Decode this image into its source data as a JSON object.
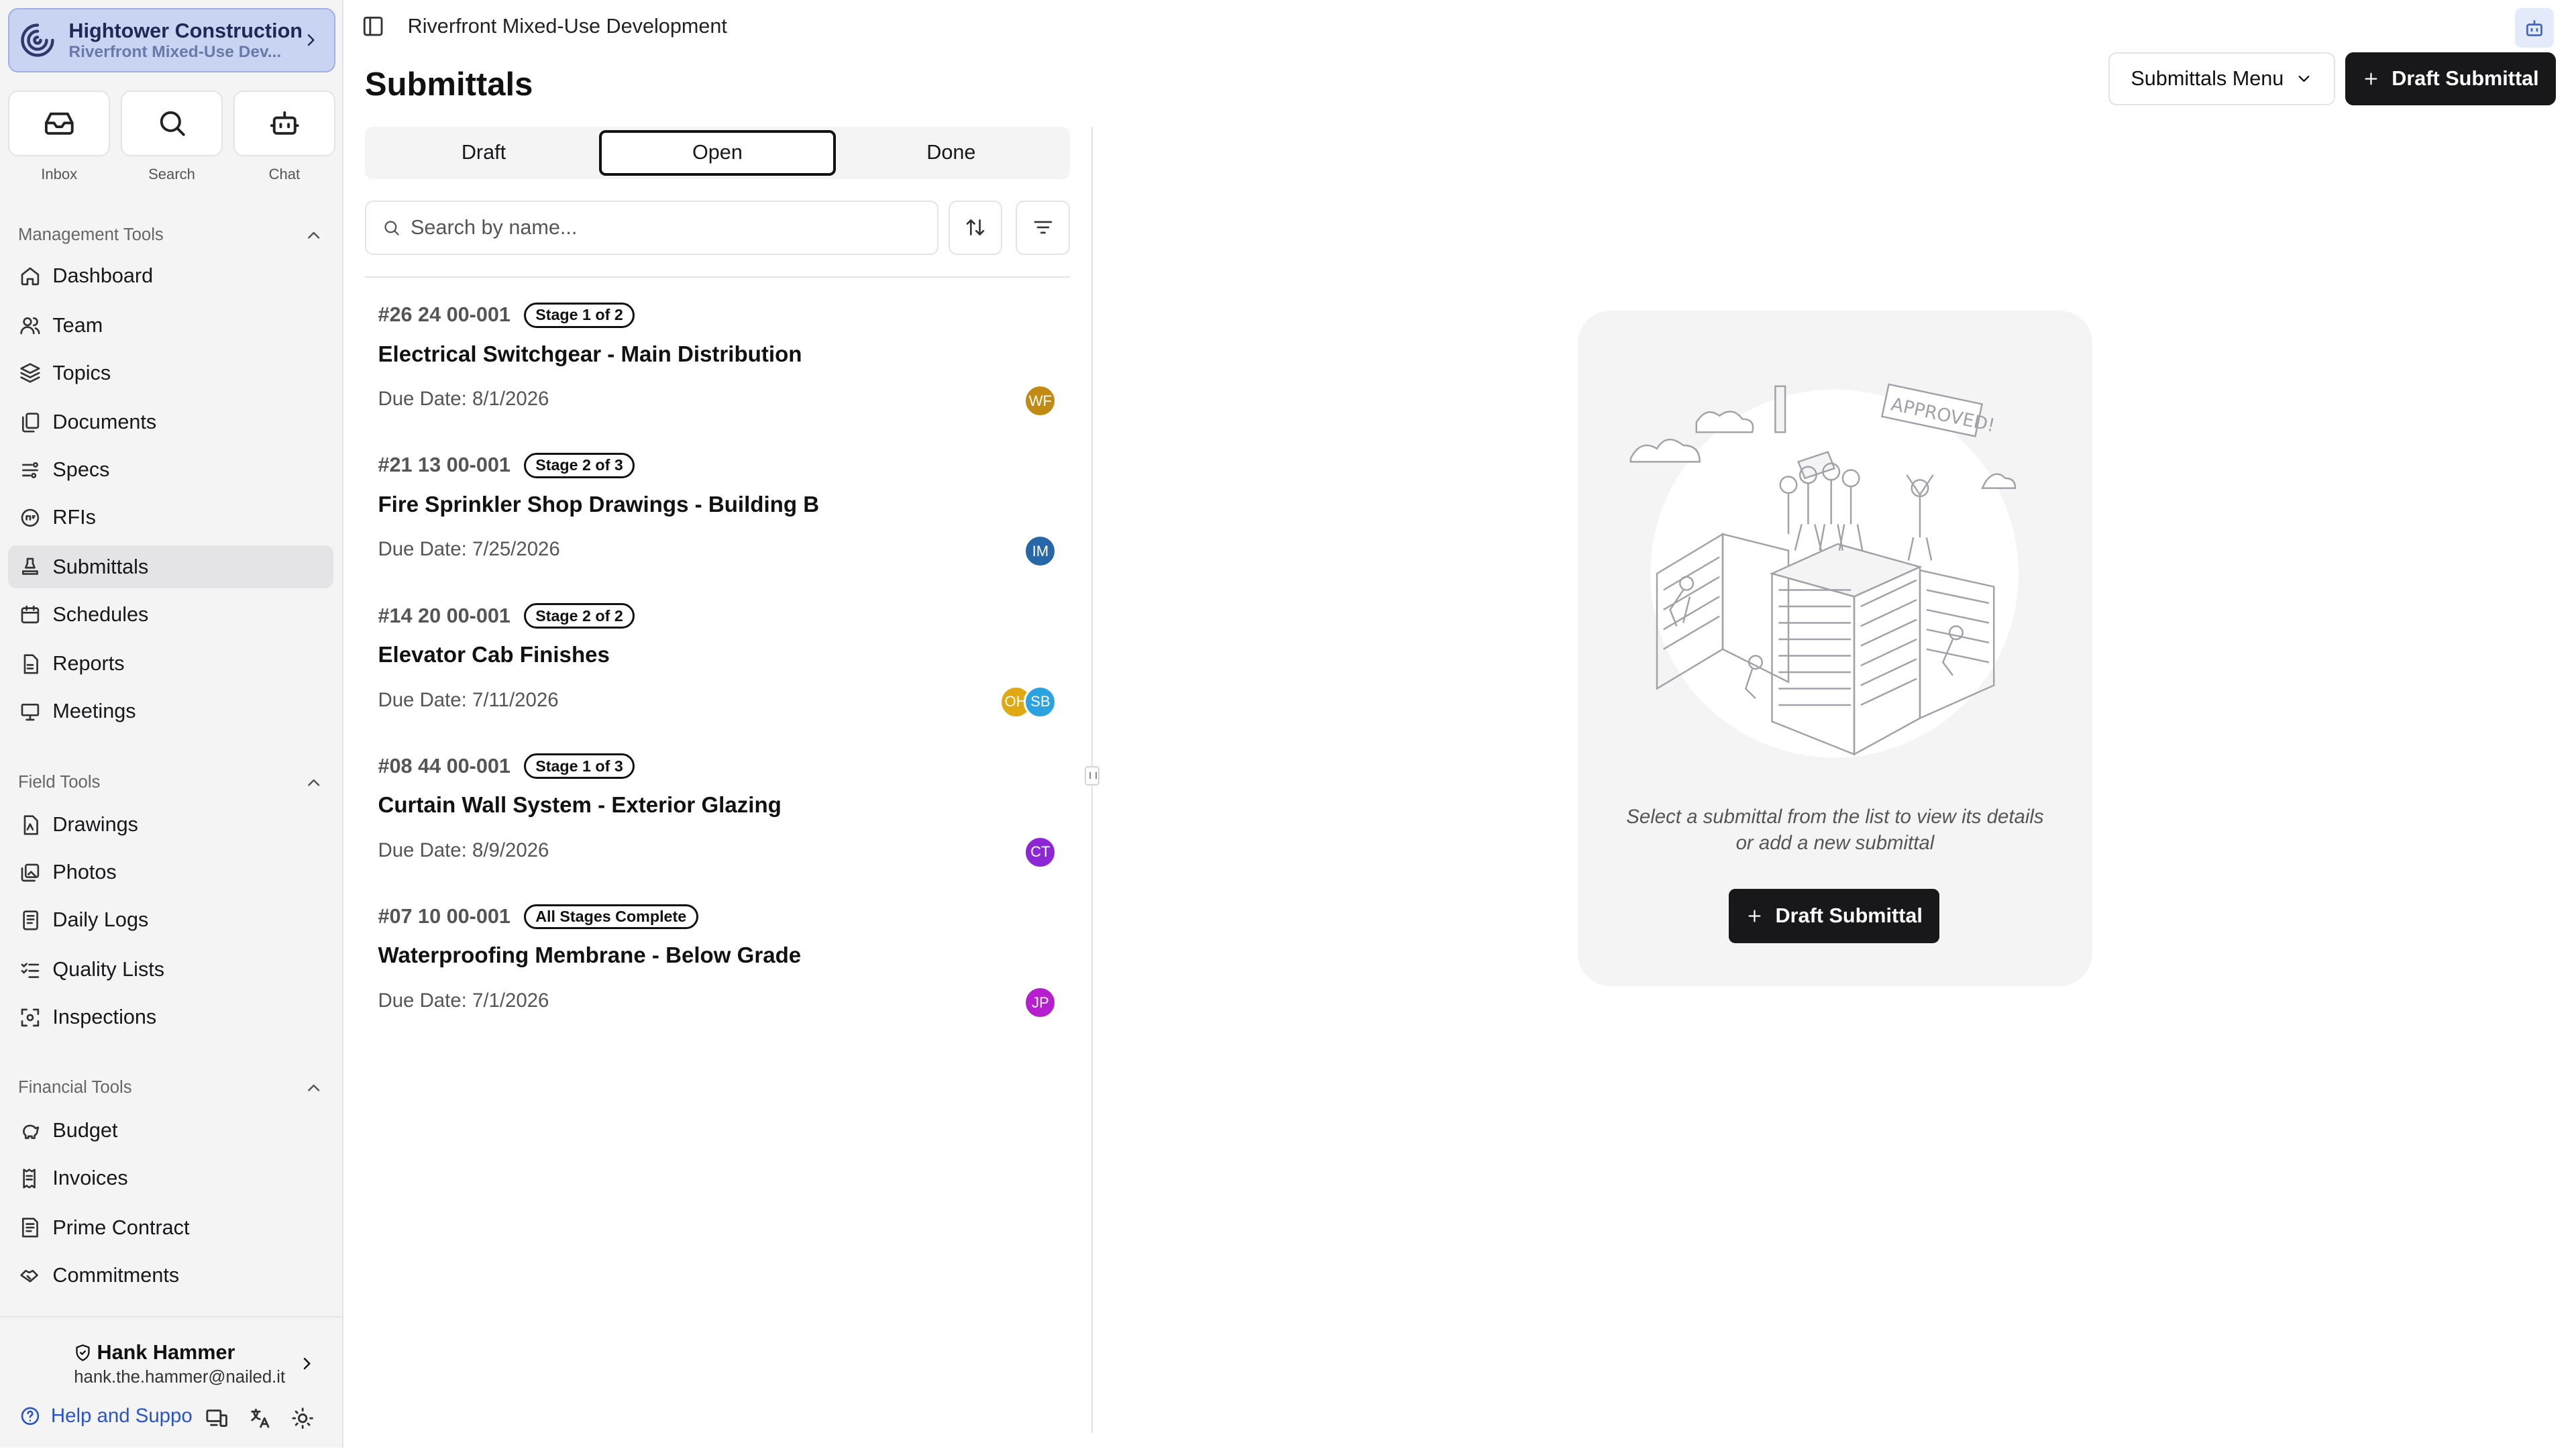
{
  "org": {
    "name": "Hightower Construction",
    "project": "Riverfront Mixed-Use Dev..."
  },
  "quick": [
    {
      "label": "Inbox",
      "icon": "inbox-icon"
    },
    {
      "label": "Search",
      "icon": "search-icon"
    },
    {
      "label": "Chat",
      "icon": "bot-icon"
    }
  ],
  "sections": {
    "management": "Management Tools",
    "field": "Field Tools",
    "financial": "Financial Tools"
  },
  "nav": {
    "management": [
      "Dashboard",
      "Team",
      "Topics",
      "Documents",
      "Specs",
      "RFIs",
      "Submittals",
      "Schedules",
      "Reports",
      "Meetings"
    ],
    "field": [
      "Drawings",
      "Photos",
      "Daily Logs",
      "Quality Lists",
      "Inspections"
    ],
    "financial": [
      "Budget",
      "Invoices",
      "Prime Contract",
      "Commitments"
    ]
  },
  "active_nav": "Submittals",
  "user": {
    "name": "Hank Hammer",
    "email": "hank.the.hammer@nailed.it"
  },
  "help": "Help and Suppo",
  "breadcrumb": "Riverfront Mixed-Use Development",
  "page_title": "Submittals",
  "header_buttons": {
    "menu": "Submittals Menu",
    "draft": "Draft Submittal"
  },
  "tabs": [
    "Draft",
    "Open",
    "Done"
  ],
  "active_tab": "Open",
  "search": {
    "placeholder": "Search by name..."
  },
  "submittals": [
    {
      "number": "#26 24 00-001",
      "stage": "Stage 1 of 2",
      "title": "Electrical Switchgear - Main Distribution",
      "due": "Due Date: 8/1/2026",
      "assignees": [
        {
          "initials": "WF",
          "color": "#c28a12"
        }
      ]
    },
    {
      "number": "#21 13 00-001",
      "stage": "Stage 2 of 3",
      "title": "Fire Sprinkler Shop Drawings - Building B",
      "due": "Due Date: 7/25/2026",
      "assignees": [
        {
          "initials": "IM",
          "color": "#2767a8"
        }
      ]
    },
    {
      "number": "#14 20 00-001",
      "stage": "Stage 2 of 2",
      "title": "Elevator Cab Finishes",
      "due": "Due Date: 7/11/2026",
      "assignees": [
        {
          "initials": "OH",
          "color": "#e0a912"
        },
        {
          "initials": "SB",
          "color": "#2aa3e0"
        }
      ]
    },
    {
      "number": "#08 44 00-001",
      "stage": "Stage 1 of 3",
      "title": "Curtain Wall System - Exterior Glazing",
      "due": "Due Date: 8/9/2026",
      "assignees": [
        {
          "initials": "CT",
          "color": "#8d27d6"
        }
      ]
    },
    {
      "number": "#07 10 00-001",
      "stage": "All Stages Complete",
      "title": "Waterproofing Membrane - Below Grade",
      "due": "Due Date: 7/1/2026",
      "assignees": [
        {
          "initials": "JP",
          "color": "#b51fce"
        }
      ]
    }
  ],
  "empty_state": {
    "line1": "Select a submittal from the list to view its details",
    "line2": "or add a new submittal",
    "button": "Draft Submittal",
    "stamp": "APPROVED!"
  },
  "colors": {
    "accent": "#18181b",
    "org_bg": "#c9d3f2",
    "link": "#2a55c9"
  }
}
